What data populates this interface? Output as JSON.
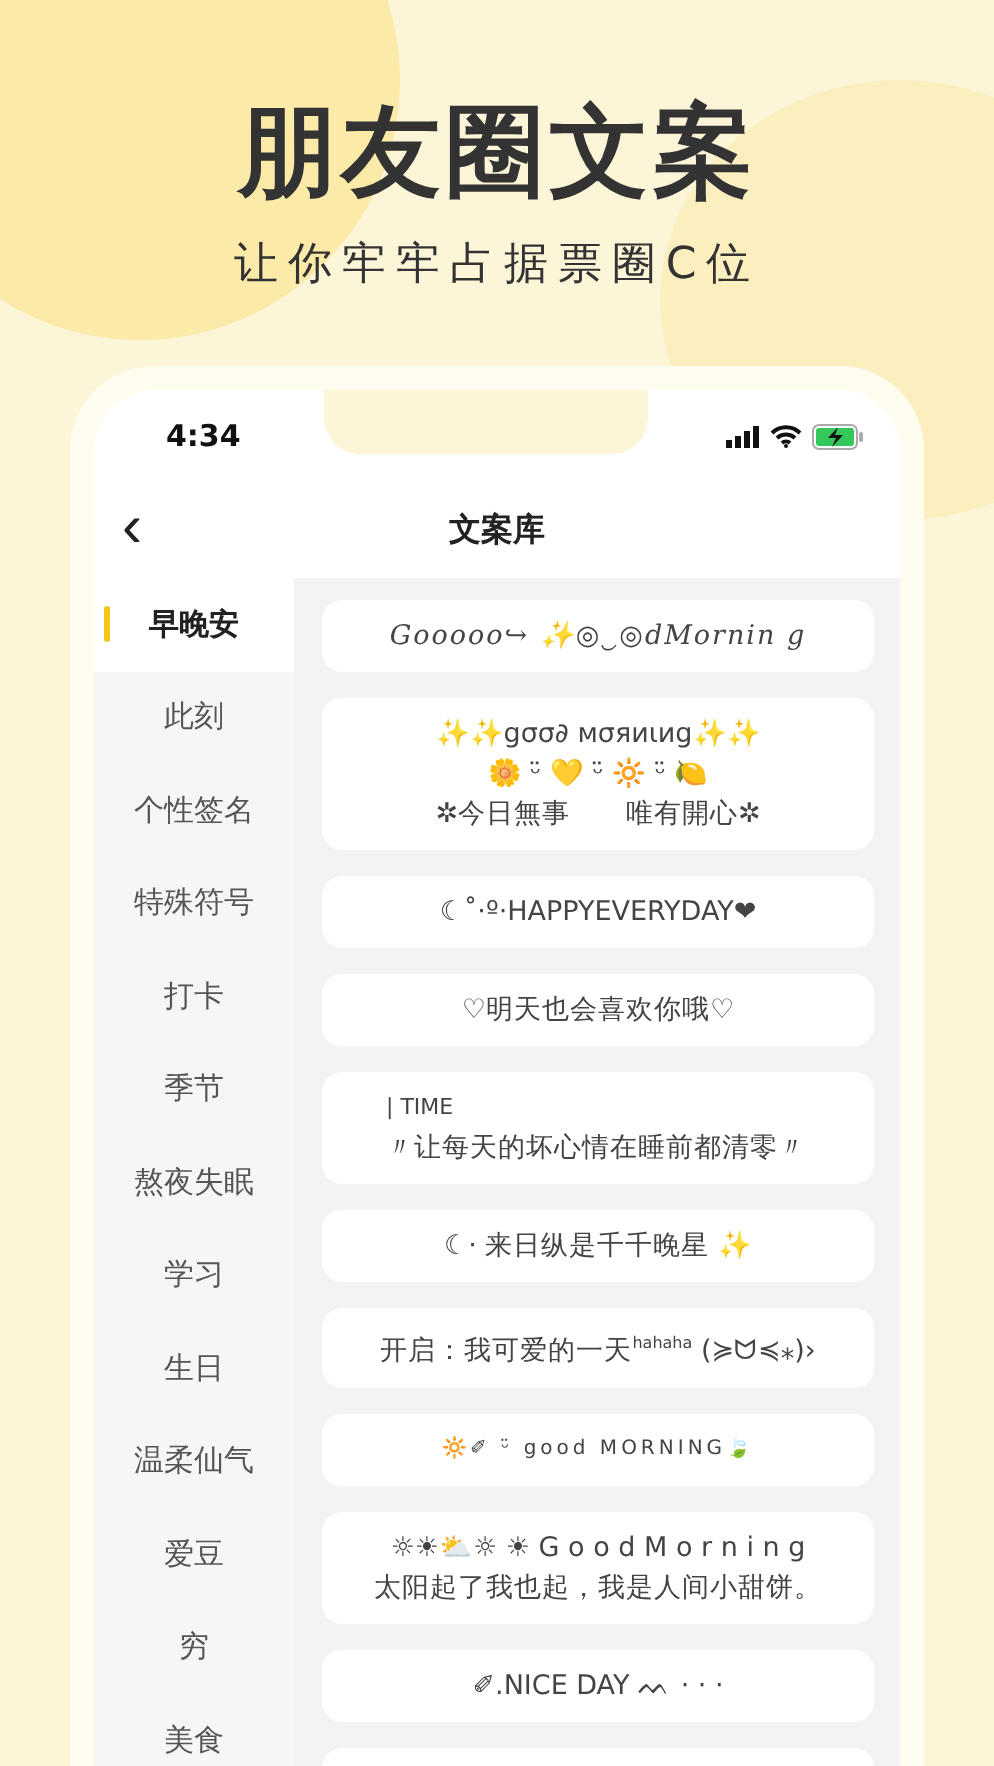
{
  "promo": {
    "title": "朋友圈文案",
    "subtitle": "让你牢牢占据票圈C位"
  },
  "status_bar": {
    "time": "4:34"
  },
  "nav": {
    "title": "文案库",
    "back": "‹"
  },
  "categories": [
    {
      "label": "早晚安",
      "selected": true
    },
    {
      "label": "此刻",
      "selected": false
    },
    {
      "label": "个性签名",
      "selected": false
    },
    {
      "label": "特殊符号",
      "selected": false
    },
    {
      "label": "打卡",
      "selected": false
    },
    {
      "label": "季节",
      "selected": false
    },
    {
      "label": "熬夜失眠",
      "selected": false
    },
    {
      "label": "学习",
      "selected": false
    },
    {
      "label": "生日",
      "selected": false
    },
    {
      "label": "温柔仙气",
      "selected": false
    },
    {
      "label": "爱豆",
      "selected": false
    },
    {
      "label": "穷",
      "selected": false
    },
    {
      "label": "美食",
      "selected": false
    }
  ],
  "cards": [
    {
      "kind": "script",
      "lines": [
        "Gooooo↪ ✨◎‿◎dMornin g"
      ]
    },
    {
      "kind": "center",
      "lines": [
        "✨✨gσσ∂ мσяиιиg✨✨",
        "🌼 ᵕ̈ 💛 ᵕ̈ 🔆 ᵕ̈ 🍋",
        "✲今日無事　　唯有開心✲"
      ]
    },
    {
      "kind": "center",
      "lines": [
        "☾˚·º·HAPPYEVERYDAY❤"
      ]
    },
    {
      "kind": "center",
      "lines": [
        "♡明天也会喜欢你哦♡"
      ]
    },
    {
      "kind": "quote",
      "lines": [
        "| TIME",
        "〃让每天的坏心情在睡前都清零〃"
      ]
    },
    {
      "kind": "center",
      "lines": [
        "☾· 来日纵是千千晚星 ✨"
      ]
    },
    {
      "kind": "center",
      "lines": [
        "开启：我可爱的一天$^{hahaha}$ (≽ᗢ≼⁎)›"
      ]
    },
    {
      "kind": "spaced",
      "lines": [
        "🔆✐ ᵕ̈ good MORNING🍃"
      ]
    },
    {
      "kind": "center",
      "lines": [
        "☼☀⛅☼ ☀ G o o d M o r n i n g",
        "太阳起了我也起，我是人间小甜饼。"
      ]
    },
    {
      "kind": "center",
      "lines": [
        "✐.NICE DAY ᨓ  ·  ·  ·"
      ]
    }
  ]
}
